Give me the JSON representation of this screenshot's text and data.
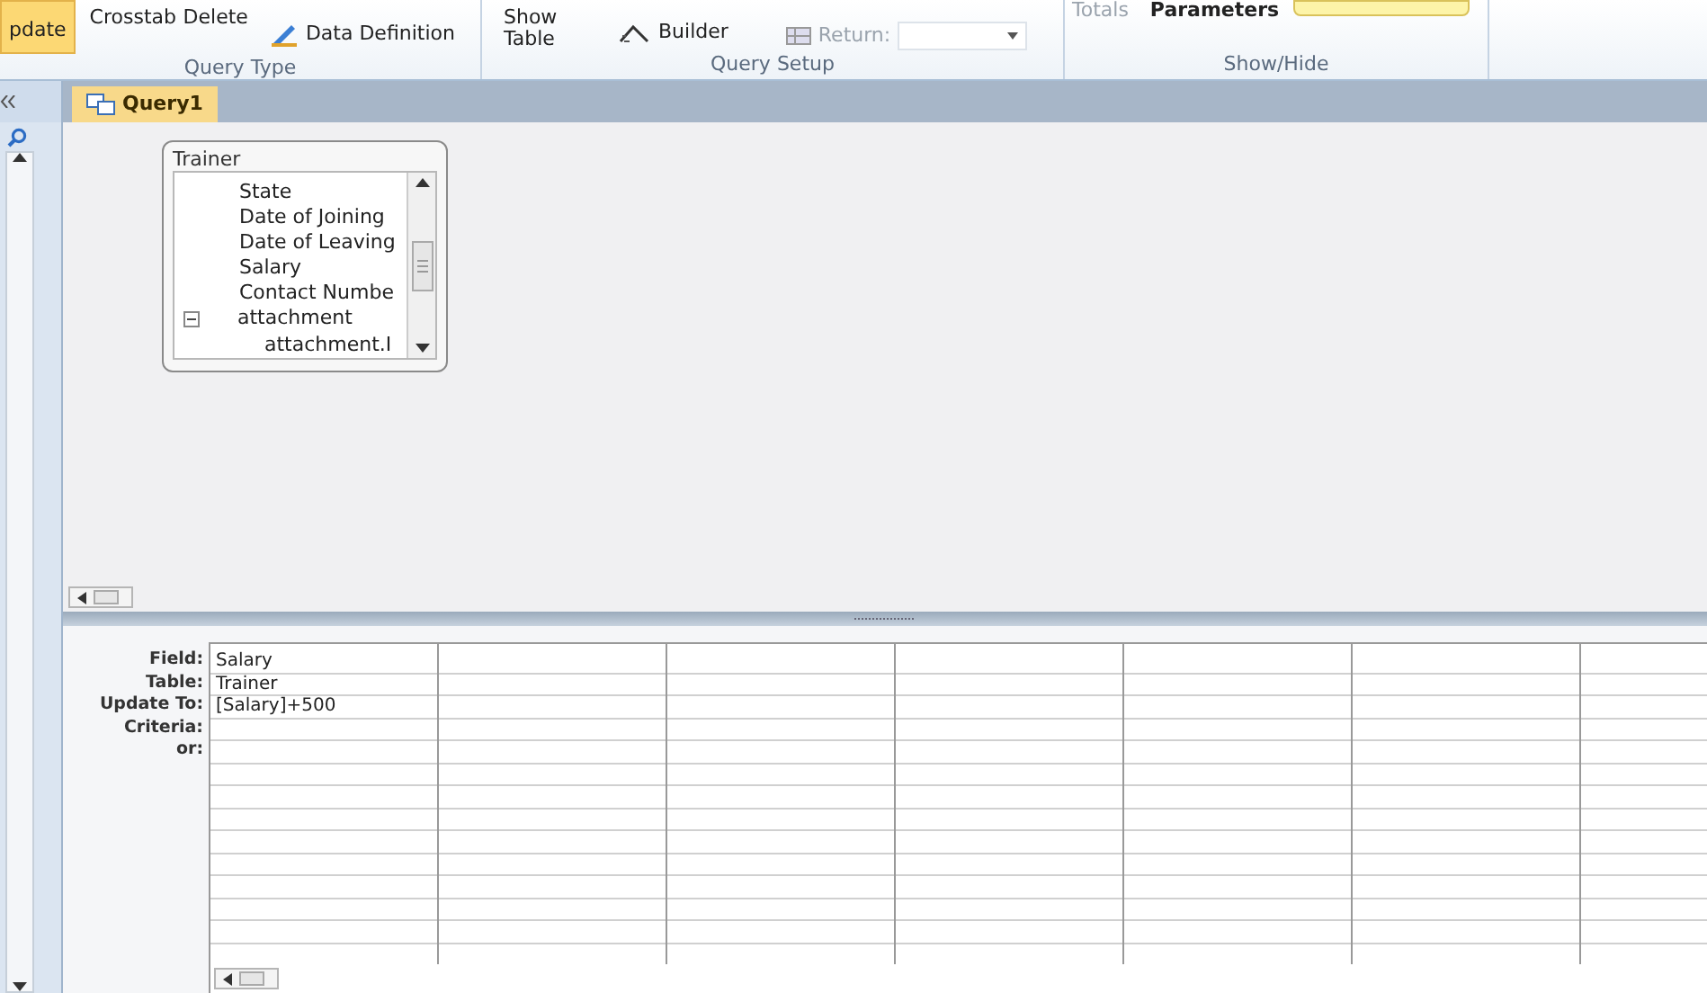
{
  "ribbon": {
    "groups": [
      {
        "label": "Query Type",
        "buttons": [
          {
            "label": "pdate",
            "kind": "large",
            "selected": true,
            "disabled": false
          },
          {
            "label": "Crosstab",
            "kind": "large",
            "selected": false,
            "disabled": false
          },
          {
            "label": "Delete",
            "kind": "large",
            "selected": false,
            "disabled": false
          },
          {
            "label": "Data Definition",
            "kind": "pencil",
            "selected": false,
            "disabled": false
          }
        ]
      },
      {
        "label": "Query Setup",
        "buttons": [
          {
            "label": "Show Table",
            "kind": "large",
            "selected": false,
            "disabled": false
          },
          {
            "label": "Builder",
            "kind": "builder",
            "selected": false,
            "disabled": false
          },
          {
            "label": "Return:",
            "kind": "return",
            "selected": false,
            "disabled": true
          }
        ]
      },
      {
        "label": "Show/Hide",
        "buttons": [
          {
            "label": "Totals",
            "kind": "small",
            "selected": false,
            "disabled": true
          },
          {
            "label": "Parameters",
            "kind": "small",
            "selected": false,
            "disabled": false
          }
        ]
      }
    ]
  },
  "document_tab": {
    "label": "Query1",
    "selected": true
  },
  "table_box": {
    "title": "Trainer",
    "fields": [
      {
        "label": "State"
      },
      {
        "label": "Date of Joining"
      },
      {
        "label": "Date of Leaving"
      },
      {
        "label": "Salary"
      },
      {
        "label": "Contact Numbe"
      },
      {
        "label": "attachment",
        "expanded": true,
        "children": [
          {
            "label": "attachment.I"
          }
        ]
      }
    ]
  },
  "design_grid": {
    "row_labels": [
      "Field:",
      "Table:",
      "Update To:",
      "Criteria:",
      "or:"
    ],
    "columns": [
      {
        "cells": [
          "Salary",
          "Trainer",
          "[Salary]+500"
        ]
      }
    ]
  }
}
